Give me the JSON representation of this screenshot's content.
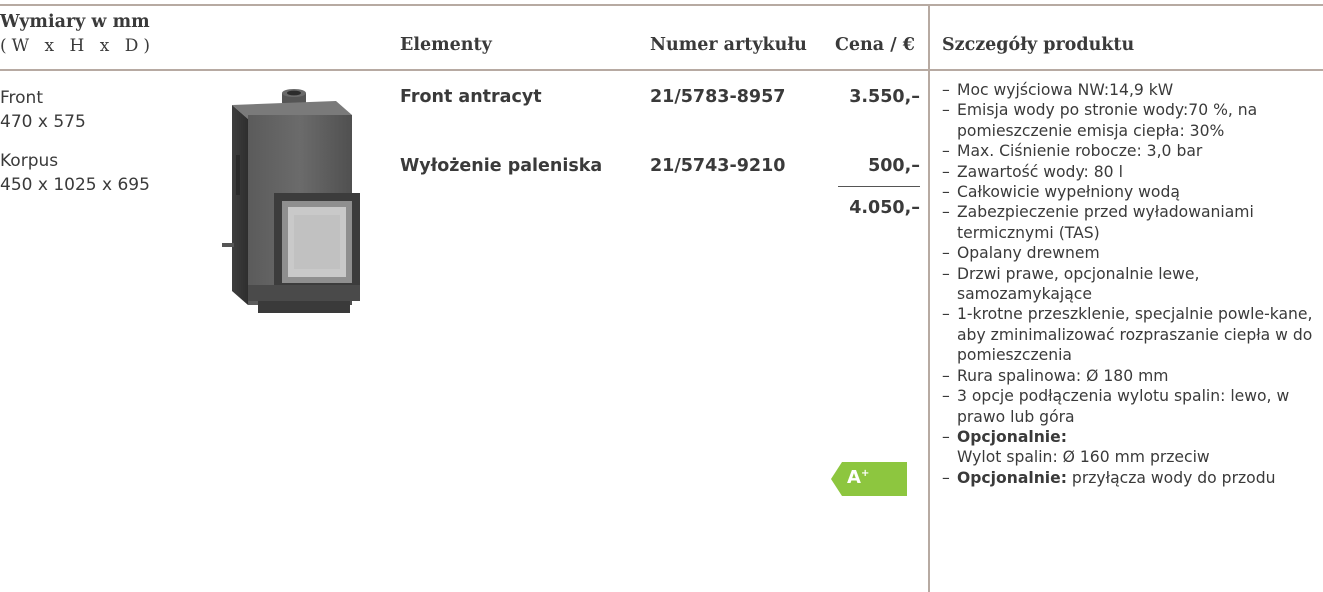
{
  "header": {
    "dimensions_title": "Wymiary w mm",
    "dimensions_subtitle": "(W x H x D)",
    "elements": "Elementy",
    "article_number": "Numer artykułu",
    "price": "Cena / €",
    "details": "Szczegóły produktu"
  },
  "dimensions": {
    "front_label": "Front",
    "front_value": "470 x 575",
    "korpus_label": "Korpus",
    "korpus_value": "450 x 1025 x 695"
  },
  "items": [
    {
      "name": "Front antracyt",
      "article": "21/5783-8957",
      "price": "3.550,–"
    },
    {
      "name": "Wyłożenie paleniska",
      "article": "21/5743-9210",
      "price": "500,–"
    }
  ],
  "total": "4.050,–",
  "energy_class": {
    "letter": "A",
    "sup": "+",
    "color": "#8dc63f"
  },
  "details": [
    {
      "text": "Moc wyjściowa NW:14,9 kW"
    },
    {
      "text": "Emisja wody po stronie wody:70 %, na pomieszczenie emisja ciepła: 30%"
    },
    {
      "text": "Max. Ciśnienie robocze: 3,0 bar"
    },
    {
      "text": "Zawartość wody: 80 l"
    },
    {
      "text": "Całkowicie wypełniony wodą"
    },
    {
      "text": "Zabezpieczenie przed wyładowaniami termicznymi (TAS)"
    },
    {
      "text": "Opalany drewnem"
    },
    {
      "text": "Drzwi prawe, opcjonalnie lewe, samozamykające"
    },
    {
      "text": "1-krotne przeszklenie, specjalnie powle-kane, aby zminimalizować rozpraszanie ciepła w do pomieszczenia"
    },
    {
      "text": "Rura spalinowa: Ø 180 mm"
    },
    {
      "text": "3 opcje podłączenia wylotu spalin: lewo, w prawo lub góra"
    },
    {
      "bold": "Opcjonalnie:",
      "text": "Wylot spalin: Ø 160 mm przeciw"
    },
    {
      "bold": "Opcjonalnie:",
      "text": "przyłącza wody do przodu"
    }
  ]
}
